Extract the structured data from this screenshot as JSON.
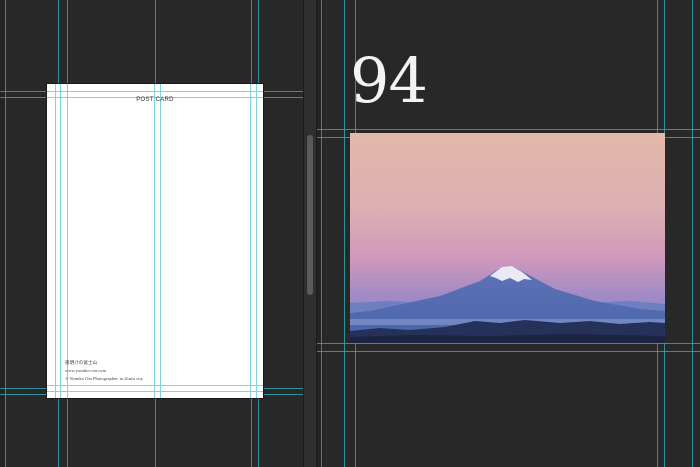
{
  "postcard": {
    "header": "POST CARD",
    "footer_lines": [
      "夜明けの富士山",
      "www.yumiko-ota.com",
      "© Yumiko Ota Photographer, in Zushi city"
    ]
  },
  "spread": {
    "page_number": "94",
    "photo_name": "mount-fuji-dawn-photo"
  },
  "colors": {
    "guide": "#2fb3c4",
    "canvas": "#282828",
    "sky_top": "#e6b9a6",
    "sky_mid": "#d09ab5",
    "sky_low": "#8a84c2"
  }
}
